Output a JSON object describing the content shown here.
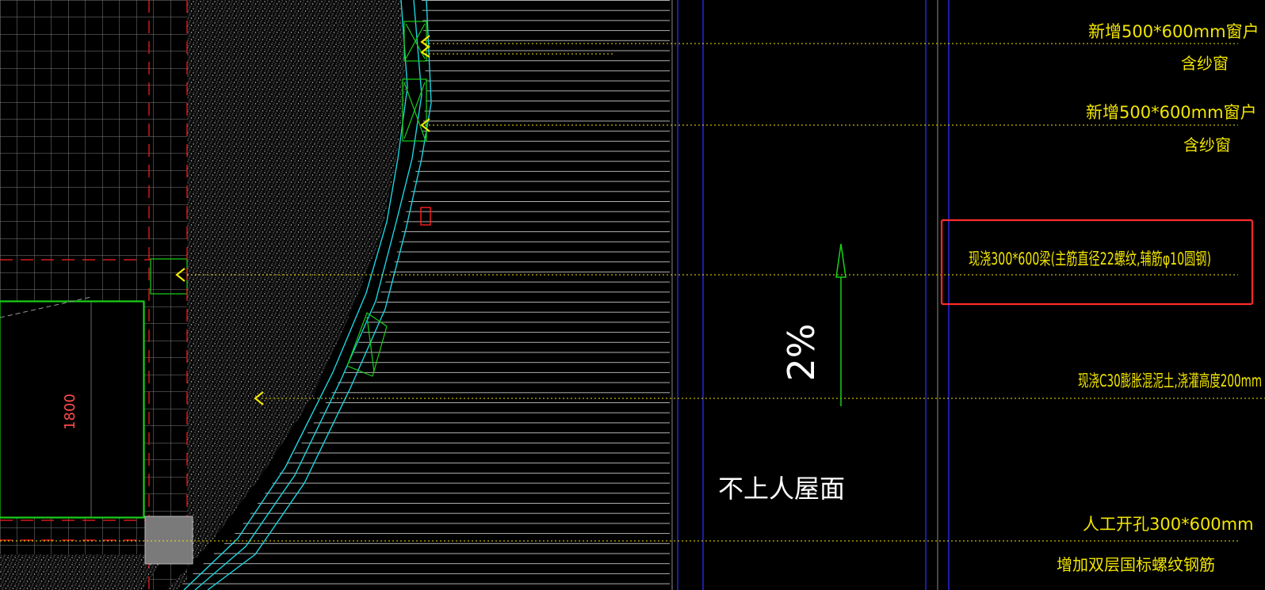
{
  "colors": {
    "background": "#000000",
    "annotation": "#f2e600",
    "tile_grid": "#7f7f7f",
    "hatch": "#b8b8b8",
    "cyan_outline": "#19d6e0",
    "green_outline": "#19d019",
    "red_dash": "#ff2020",
    "blue_line": "#2b2bff",
    "highlight_box": "#ff2b2b",
    "white_text": "#ffffff"
  },
  "annotations": [
    {
      "id": "window-note-1",
      "text": "新增500*600mm窗户"
    },
    {
      "id": "screen-note-1",
      "text": "含纱窗"
    },
    {
      "id": "window-note-2",
      "text": "新增500*600mm窗户"
    },
    {
      "id": "screen-note-2",
      "text": "含纱窗"
    },
    {
      "id": "beam-note",
      "text": "现浇300*600梁(主筋直径22螺纹,辅筋φ10圆钢)"
    },
    {
      "id": "concrete-note",
      "text": "现浇C30膨胀混泥土,浇灌高度200mm"
    },
    {
      "id": "opening-note",
      "text": "人工开孔300*600mm"
    },
    {
      "id": "rebar-note",
      "text": "增加双层国标螺纹钢筋"
    }
  ],
  "drawing": {
    "slope_label": "2%",
    "roof_label": "不上人屋面",
    "dimension_label": "1800",
    "slope_arrow_icon": "up-arrow-icon",
    "leader_icon": "chevron-left-icon"
  }
}
